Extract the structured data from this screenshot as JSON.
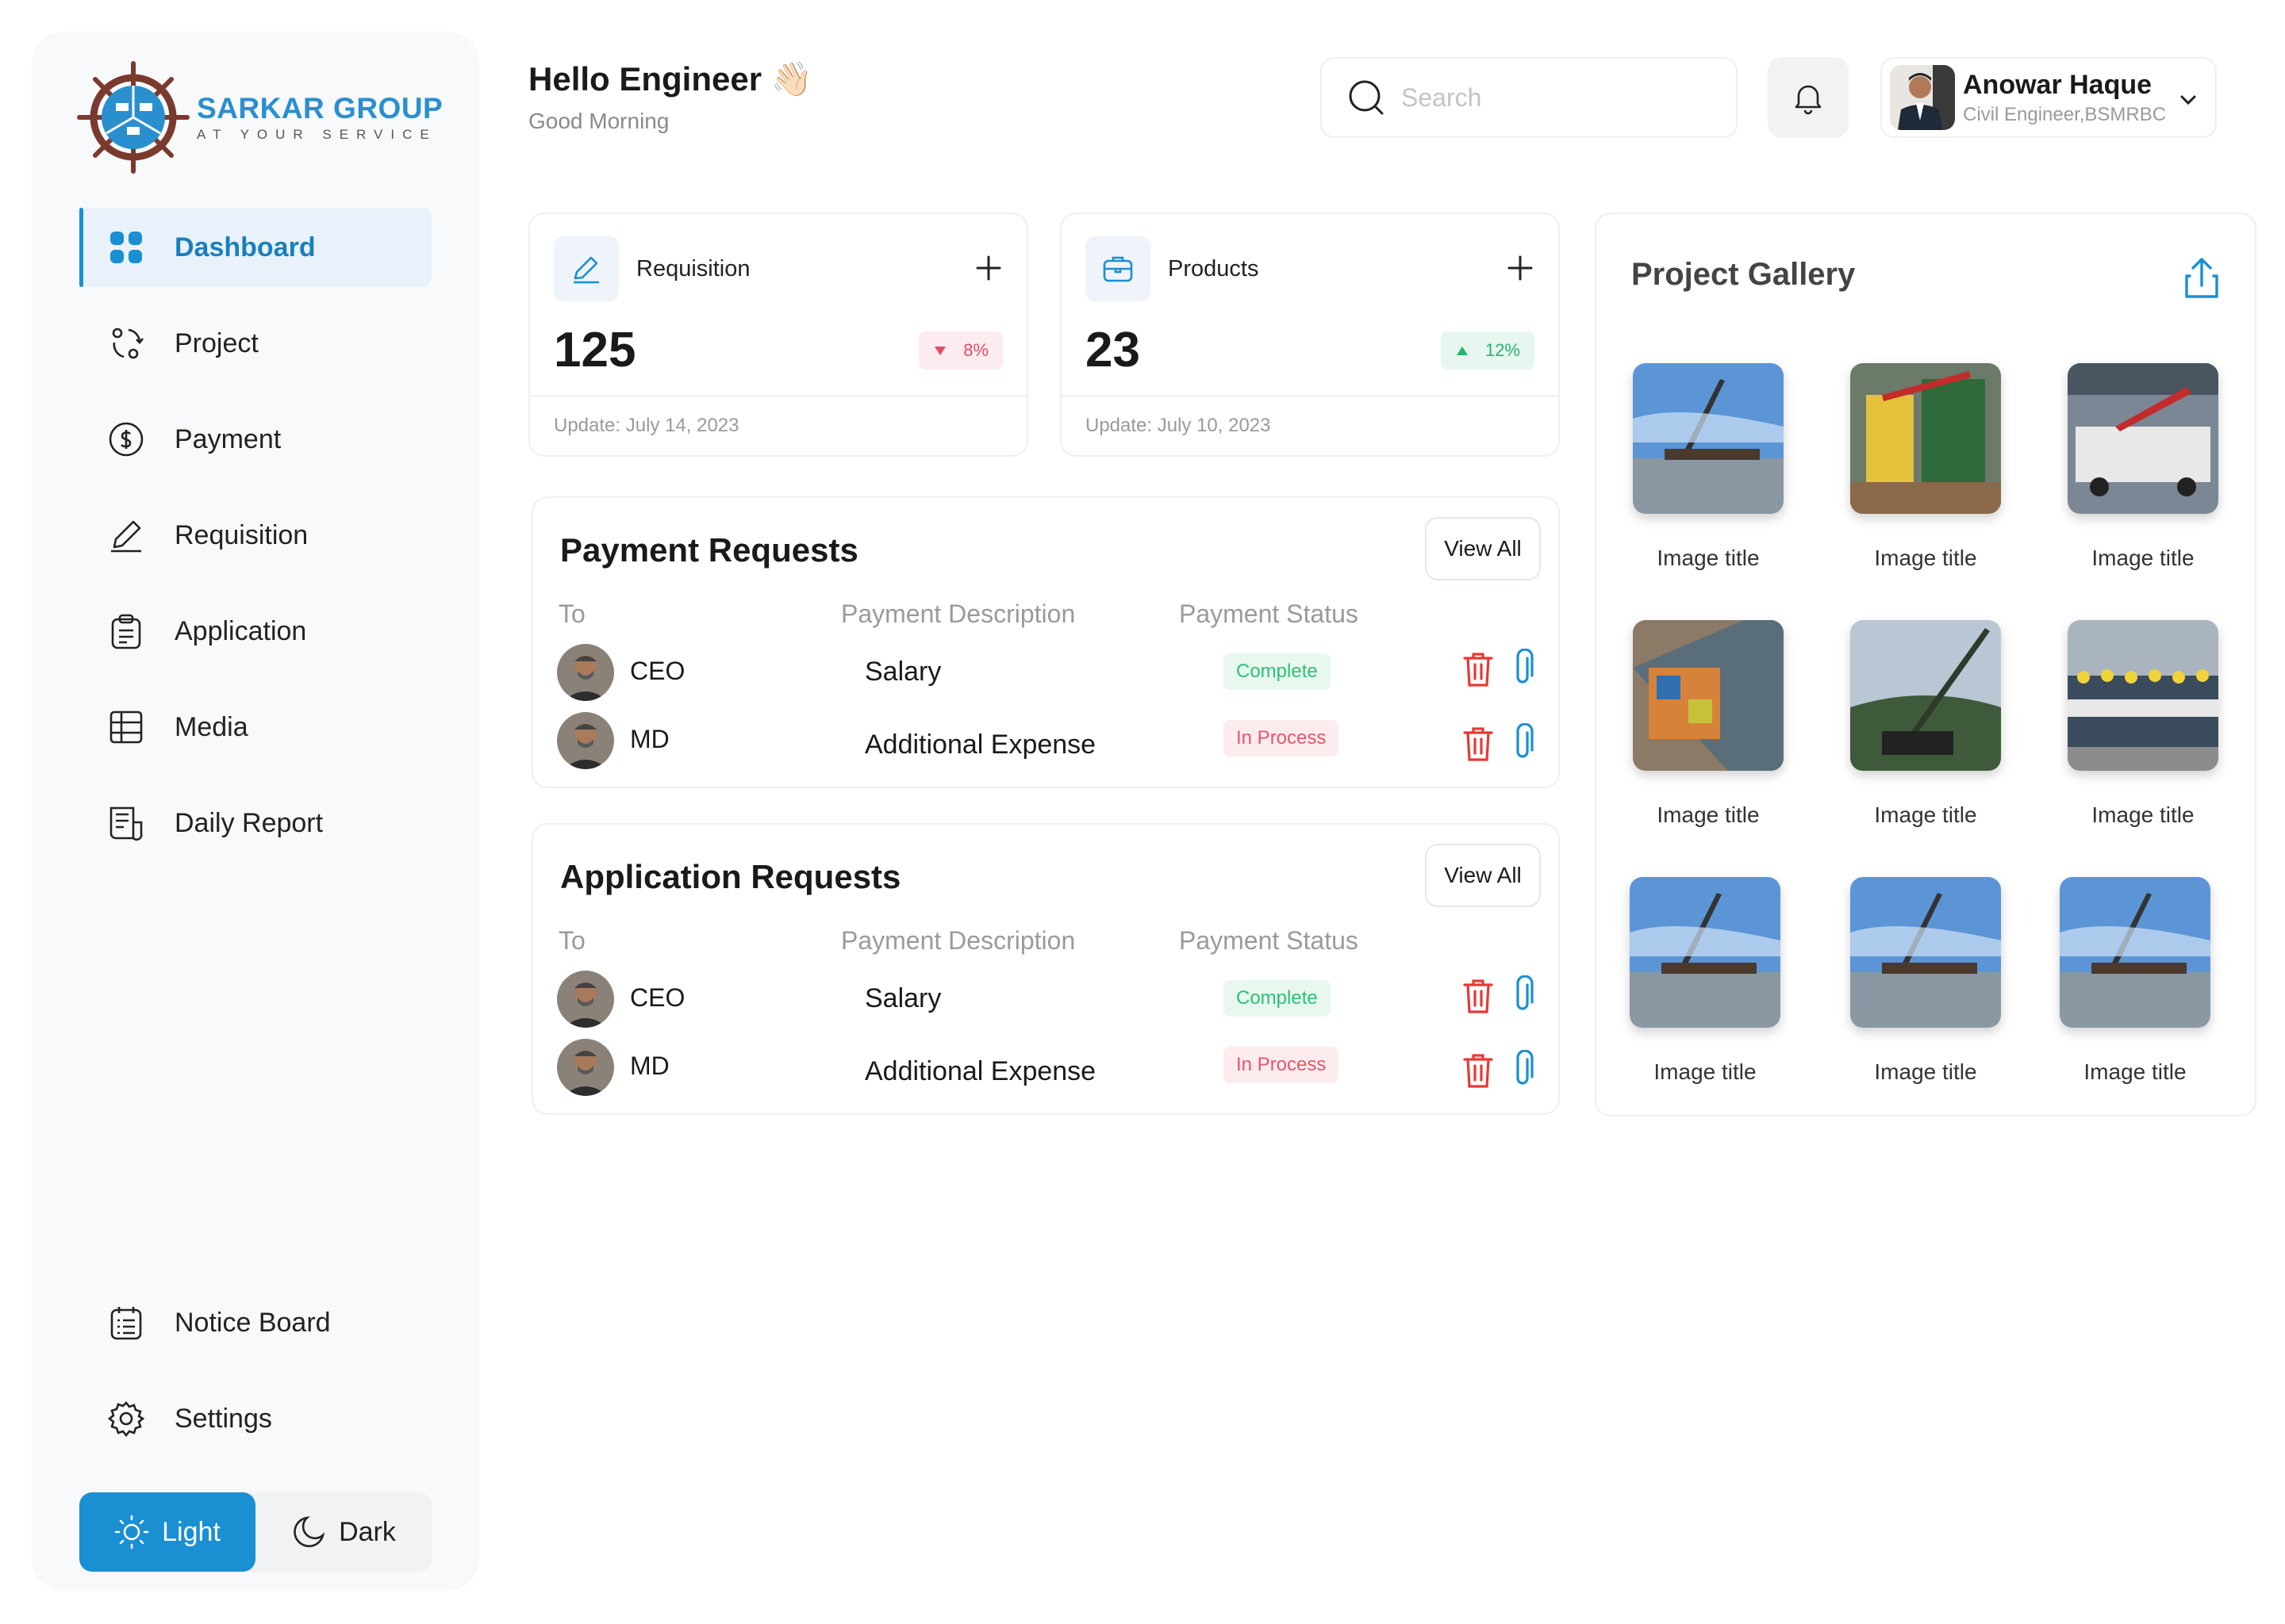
{
  "brand": {
    "name": "SARKAR GROUP",
    "tagline": "AT YOUR SERVICE"
  },
  "sidebar": {
    "items": [
      {
        "label": "Dashboard",
        "icon": "grid-icon"
      },
      {
        "label": "Project",
        "icon": "project-icon"
      },
      {
        "label": "Payment",
        "icon": "dollar-circle-icon"
      },
      {
        "label": "Requisition",
        "icon": "pen-icon"
      },
      {
        "label": "Application",
        "icon": "clipboard-icon"
      },
      {
        "label": "Media",
        "icon": "table-icon"
      },
      {
        "label": "Daily Report",
        "icon": "report-icon"
      }
    ],
    "bottom_items": [
      {
        "label": "Notice Board",
        "icon": "notice-icon"
      },
      {
        "label": "Settings",
        "icon": "gear-icon"
      }
    ],
    "theme": {
      "light": "Light",
      "dark": "Dark",
      "selected": "Light"
    }
  },
  "header": {
    "title": "Hello Engineer",
    "emoji": "👋🏻",
    "subtitle": "Good Morning",
    "search_placeholder": "Search",
    "user": {
      "name": "Anowar Haque",
      "role": "Civil Engineer,BSMRBC"
    }
  },
  "stats": [
    {
      "label": "Requisition",
      "value": "125",
      "change": "8%",
      "trend": "down",
      "updated": "Update: July 14, 2023"
    },
    {
      "label": "Products",
      "value": "23",
      "change": "12%",
      "trend": "up",
      "updated": "Update: July 10, 2023"
    }
  ],
  "payment_requests": {
    "title": "Payment Requests",
    "view_all": "View All",
    "columns": [
      "To",
      "Payment Description",
      "Payment Status"
    ],
    "rows": [
      {
        "to": "CEO",
        "description": "Salary",
        "status": "Complete"
      },
      {
        "to": "MD",
        "description": "Additional Expense",
        "status": "In Process"
      }
    ]
  },
  "application_requests": {
    "title": "Application Requests",
    "view_all": "View All",
    "columns": [
      "To",
      "Payment Description",
      "Payment Status"
    ],
    "rows": [
      {
        "to": "CEO",
        "description": "Salary",
        "status": "Complete"
      },
      {
        "to": "MD",
        "description": "Additional Expense",
        "status": "In Process"
      }
    ]
  },
  "gallery": {
    "title": "Project Gallery",
    "items": [
      {
        "caption": "Image title"
      },
      {
        "caption": "Image title"
      },
      {
        "caption": "Image title"
      },
      {
        "caption": "Image title"
      },
      {
        "caption": "Image title"
      },
      {
        "caption": "Image title"
      },
      {
        "caption": "Image title"
      },
      {
        "caption": "Image title"
      },
      {
        "caption": "Image title"
      }
    ]
  },
  "colors": {
    "accent": "#1a8fd2",
    "complete": "#2fbf77",
    "in_process": "#e4566c",
    "delete": "#e53935",
    "attach": "#1a8fd2"
  }
}
